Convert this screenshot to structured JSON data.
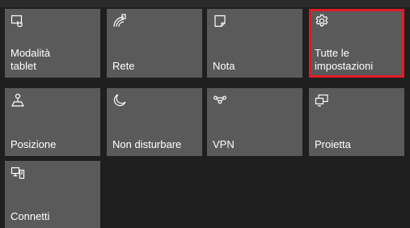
{
  "quick_actions": {
    "tiles": [
      {
        "label": "Modalità\ntablet",
        "icon": "tablet-mode-icon"
      },
      {
        "label": "Rete",
        "icon": "network-icon"
      },
      {
        "label": "Nota",
        "icon": "note-icon"
      },
      {
        "label": "Tutte le\nimpostazioni",
        "icon": "gear-icon",
        "selected": true
      },
      {
        "label": "Posizione",
        "icon": "location-icon"
      },
      {
        "label": "Non disturbare",
        "icon": "moon-icon"
      },
      {
        "label": "VPN",
        "icon": "vpn-icon"
      },
      {
        "label": "Proietta",
        "icon": "project-icon"
      },
      {
        "label": "Connetti",
        "icon": "connect-icon"
      }
    ],
    "colors": {
      "tile_bg": "#5a5a5a",
      "panel_bg": "#1f1f1f",
      "selection_outline": "#e01b24",
      "text": "#ffffff"
    }
  }
}
